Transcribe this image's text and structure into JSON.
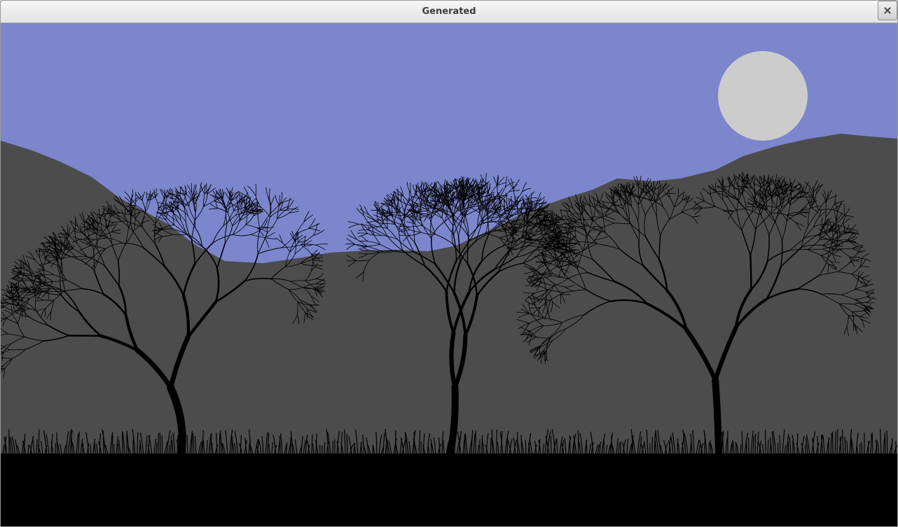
{
  "window": {
    "title": "Generated",
    "close_icon": "close-icon"
  },
  "scene": {
    "colors": {
      "sky": "#7b86cc",
      "mountains": "#4c4c4c",
      "moon": "#cccccc",
      "silhouette": "#000000"
    }
  }
}
